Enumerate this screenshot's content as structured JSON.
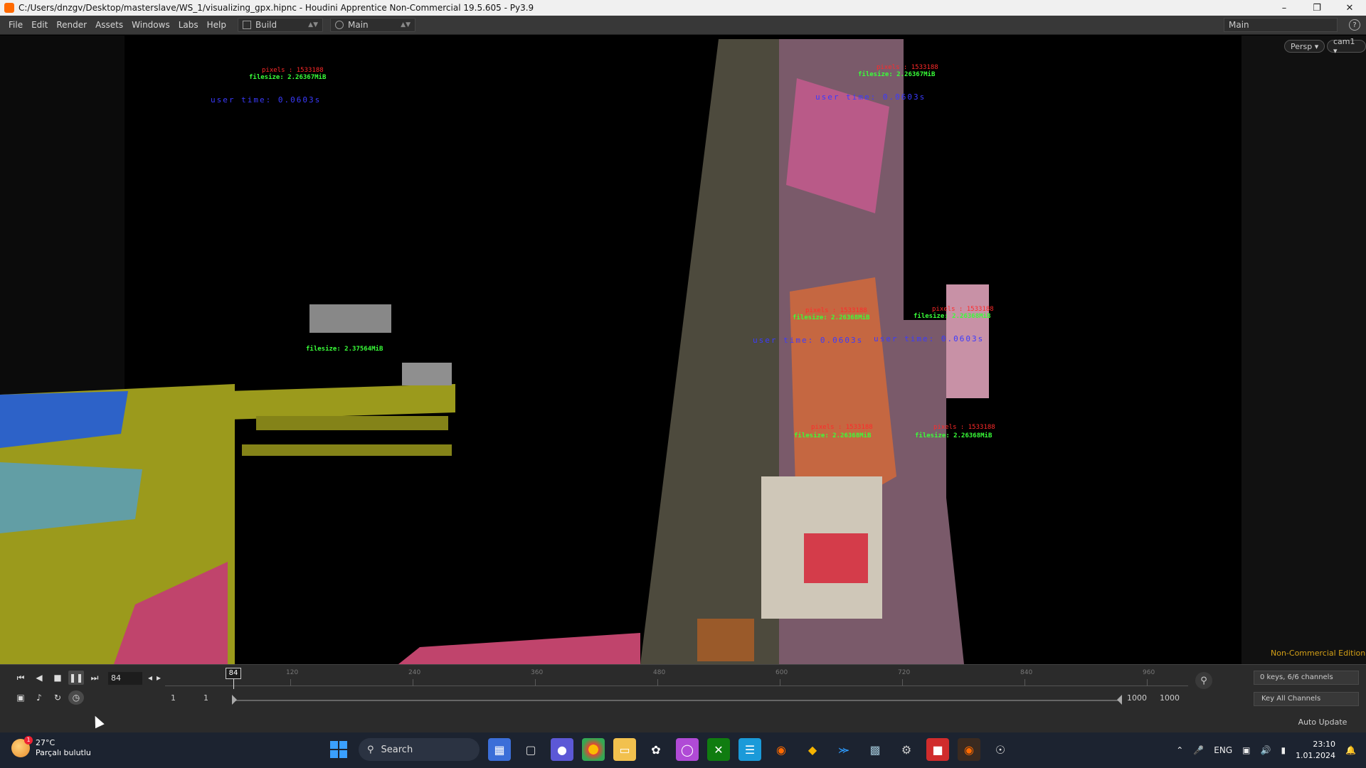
{
  "window": {
    "title": "C:/Users/dnzgv/Desktop/masterslave/WS_1/visualizing_gpx.hipnc - Houdini Apprentice Non-Commercial 19.5.605 - Py3.9",
    "minimize_glyph": "–",
    "maximize_glyph": "❐",
    "close_glyph": "✕"
  },
  "menubar": {
    "items": [
      "File",
      "Edit",
      "Render",
      "Assets",
      "Windows",
      "Labs",
      "Help"
    ],
    "desktop_build": "Build",
    "desktop_main": "Main",
    "right_desktop": "Main",
    "help_glyph": "?"
  },
  "viewport": {
    "camera_menu": "Persp ▾",
    "cam_menu": "cam1 ▾",
    "watermark": "Non-Commercial Edition",
    "hud_red": [
      "pixels : 1533188",
      "pixels : 1533188",
      "pixels : 1533188",
      "pixels : 1533188",
      "pixels : 1533188",
      "pixels : 1533188"
    ],
    "hud_green": [
      "filesize: 2.26367MiB",
      "filesize: 2.26367MiB",
      "filesize: 2.26368MiB",
      "filesize: 2.26368MiB",
      "filesize: 2.26368MiB",
      "filesize: 2.26368MiB",
      "filesize: 2.37564MiB"
    ],
    "hud_blue": [
      "user time: 0.0603s",
      "user time: 0.0603s",
      "user time: 0.0603s",
      "user time: 0.0603s"
    ]
  },
  "timeline": {
    "current_frame": "84",
    "frame_marker": "84",
    "ruler_labels": [
      "120",
      "240",
      "360",
      "480",
      "600",
      "720",
      "840",
      "960"
    ],
    "keys_channels": "0 keys, 6/6 channels",
    "key_all_channels": "Key All Channels",
    "range_start_a": "1",
    "range_start_b": "1",
    "range_end_a": "1000",
    "range_end_b": "1000",
    "auto_update": "Auto Update",
    "playhead_fraction": 0.0668
  },
  "taskbar": {
    "temperature": "27°C",
    "weather_desc": "Parçalı bulutlu",
    "weather_badge": "1",
    "search_label": "Search",
    "language": "ENG",
    "time": "23:10",
    "date": "1.01.2024"
  }
}
